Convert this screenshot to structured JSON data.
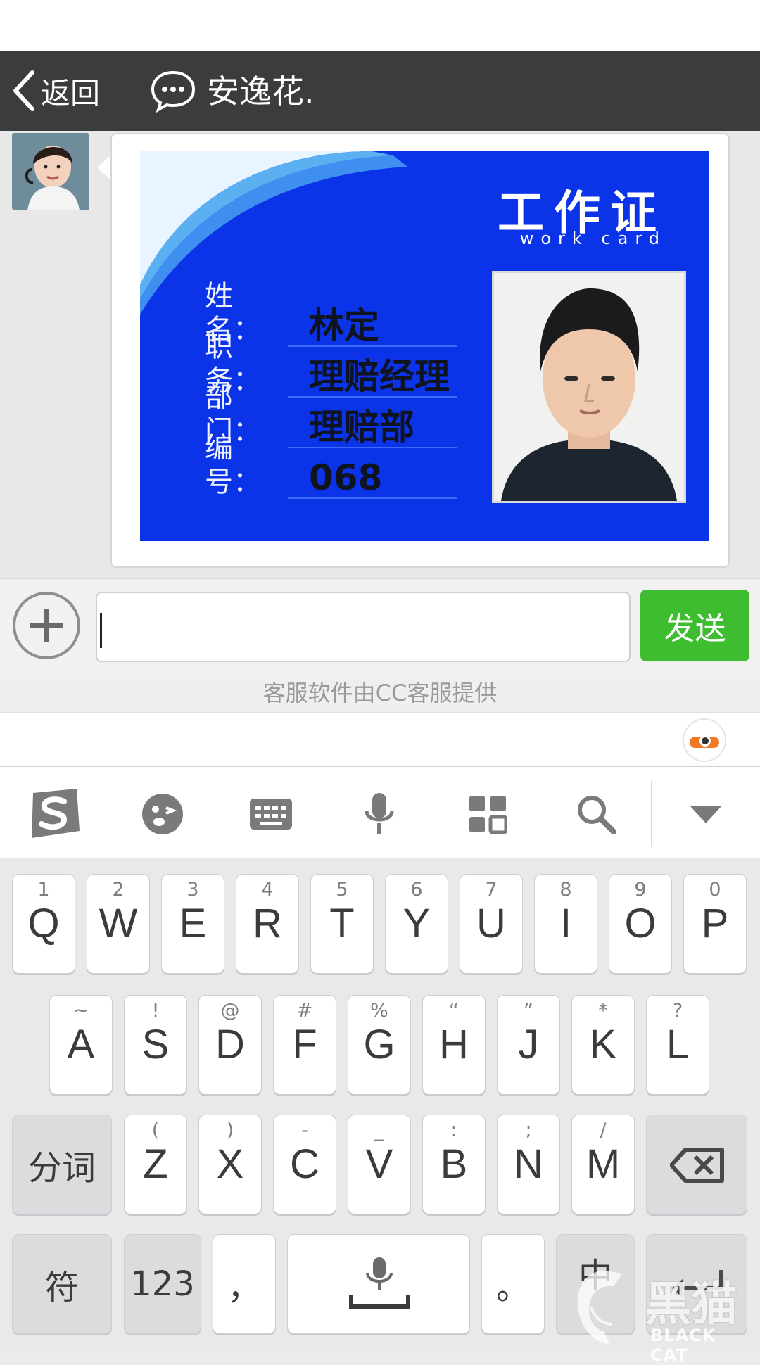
{
  "header": {
    "back_label": "返回",
    "title": "安逸花."
  },
  "card": {
    "title": "工作证",
    "subtitle": "work card",
    "fields": [
      {
        "label": "姓名：",
        "value": "林定"
      },
      {
        "label": "职务：",
        "value": "理赔经理"
      },
      {
        "label": "部门：",
        "value": "理赔部"
      },
      {
        "label": "编号：",
        "value": "068"
      }
    ]
  },
  "input": {
    "send_label": "发送",
    "value": ""
  },
  "provider_text": "客服软件由CC客服提供",
  "toolbar": {
    "icons": [
      "sogou-logo-icon",
      "emoji-icon",
      "keyboard-icon",
      "microphone-icon",
      "apps-grid-icon",
      "search-icon",
      "collapse-icon"
    ]
  },
  "keyboard": {
    "row1": [
      {
        "main": "Q",
        "sub": "1"
      },
      {
        "main": "W",
        "sub": "2"
      },
      {
        "main": "E",
        "sub": "3"
      },
      {
        "main": "R",
        "sub": "4"
      },
      {
        "main": "T",
        "sub": "5"
      },
      {
        "main": "Y",
        "sub": "6"
      },
      {
        "main": "U",
        "sub": "7"
      },
      {
        "main": "I",
        "sub": "8"
      },
      {
        "main": "O",
        "sub": "9"
      },
      {
        "main": "P",
        "sub": "0"
      }
    ],
    "row2": [
      {
        "main": "A",
        "sub": "~"
      },
      {
        "main": "S",
        "sub": "!"
      },
      {
        "main": "D",
        "sub": "@"
      },
      {
        "main": "F",
        "sub": "#"
      },
      {
        "main": "G",
        "sub": "%"
      },
      {
        "main": "H",
        "sub": "“"
      },
      {
        "main": "J",
        "sub": "”"
      },
      {
        "main": "K",
        "sub": "*"
      },
      {
        "main": "L",
        "sub": "?"
      }
    ],
    "row3": [
      {
        "main": "Z",
        "sub": "("
      },
      {
        "main": "X",
        "sub": ")"
      },
      {
        "main": "C",
        "sub": "-"
      },
      {
        "main": "V",
        "sub": "_"
      },
      {
        "main": "B",
        "sub": ":"
      },
      {
        "main": "N",
        "sub": ";"
      },
      {
        "main": "M",
        "sub": "/"
      }
    ],
    "segment_label": "分词",
    "symbol_label": "符",
    "num_label": "123",
    "comma_label": "，",
    "period_label": "。",
    "lang_label": "中"
  },
  "watermark": {
    "cn": "黑猫",
    "en": "BLACK CAT"
  }
}
